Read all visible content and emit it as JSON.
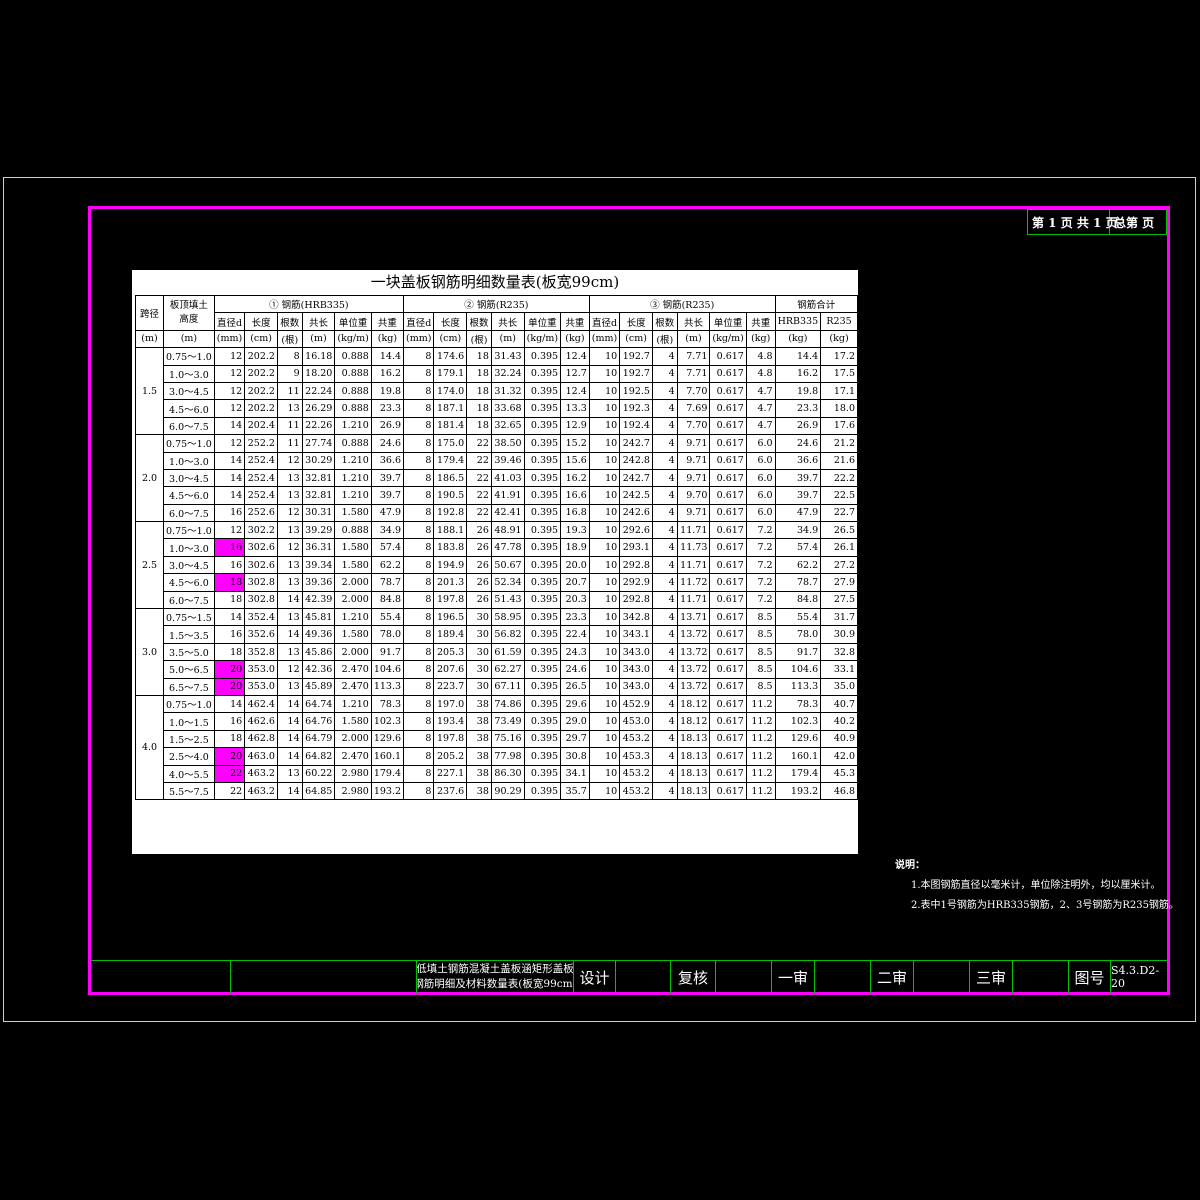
{
  "page_box": {
    "page_info": "第 1 页 共 1 页",
    "total_page": "总第   页"
  },
  "table_title": "一块盖板钢筋明细数量表(板宽99cm)",
  "headers": {
    "span": "跨径",
    "span_unit": "(m)",
    "fill": "板顶填土高度",
    "fill_unit": "(m)",
    "g1": "① 钢筋(HRB335)",
    "g2": "② 钢筋(R235)",
    "g3": "③ 钢筋(R235)",
    "g4": "钢筋合计",
    "dia": "直径d",
    "len": "长度",
    "cnt": "根数",
    "tot": "共长",
    "uw": "单位重",
    "wt": "共重",
    "hrb": "HRB335",
    "r235": "R235",
    "u_dia": "(mm)",
    "u_len": "(cm)",
    "u_cnt": "(根)",
    "u_tot": "(m)",
    "u_uw": "(kg/m)",
    "u_wt": "(kg)"
  },
  "groups": [
    {
      "span": "1.5",
      "rows": [
        {
          "h": "0.75～1.0",
          "d1": "12",
          "l1": "202.2",
          "n1": "8",
          "t1": "16.18",
          "u1": "0.888",
          "w1": "14.4",
          "d2": "8",
          "l2": "174.6",
          "n2": "18",
          "t2": "31.43",
          "u2": "0.395",
          "w2": "12.4",
          "d3": "10",
          "l3": "192.7",
          "n3": "4",
          "t3": "7.71",
          "u3": "0.617",
          "w3": "4.8",
          "s1": "14.4",
          "s2": "17.2"
        },
        {
          "h": "1.0～3.0",
          "d1": "12",
          "l1": "202.2",
          "n1": "9",
          "t1": "18.20",
          "u1": "0.888",
          "w1": "16.2",
          "d2": "8",
          "l2": "179.1",
          "n2": "18",
          "t2": "32.24",
          "u2": "0.395",
          "w2": "12.7",
          "d3": "10",
          "l3": "192.7",
          "n3": "4",
          "t3": "7.71",
          "u3": "0.617",
          "w3": "4.8",
          "s1": "16.2",
          "s2": "17.5"
        },
        {
          "h": "3.0～4.5",
          "d1": "12",
          "l1": "202.2",
          "n1": "11",
          "t1": "22.24",
          "u1": "0.888",
          "w1": "19.8",
          "d2": "8",
          "l2": "174.0",
          "n2": "18",
          "t2": "31.32",
          "u2": "0.395",
          "w2": "12.4",
          "d3": "10",
          "l3": "192.5",
          "n3": "4",
          "t3": "7.70",
          "u3": "0.617",
          "w3": "4.7",
          "s1": "19.8",
          "s2": "17.1"
        },
        {
          "h": "4.5～6.0",
          "d1": "12",
          "l1": "202.2",
          "n1": "13",
          "t1": "26.29",
          "u1": "0.888",
          "w1": "23.3",
          "d2": "8",
          "l2": "187.1",
          "n2": "18",
          "t2": "33.68",
          "u2": "0.395",
          "w2": "13.3",
          "d3": "10",
          "l3": "192.3",
          "n3": "4",
          "t3": "7.69",
          "u3": "0.617",
          "w3": "4.7",
          "s1": "23.3",
          "s2": "18.0"
        },
        {
          "h": "6.0～7.5",
          "d1": "14",
          "l1": "202.4",
          "n1": "11",
          "t1": "22.26",
          "u1": "1.210",
          "w1": "26.9",
          "d2": "8",
          "l2": "181.4",
          "n2": "18",
          "t2": "32.65",
          "u2": "0.395",
          "w2": "12.9",
          "d3": "10",
          "l3": "192.4",
          "n3": "4",
          "t3": "7.70",
          "u3": "0.617",
          "w3": "4.7",
          "s1": "26.9",
          "s2": "17.6"
        }
      ]
    },
    {
      "span": "2.0",
      "rows": [
        {
          "h": "0.75～1.0",
          "d1": "12",
          "l1": "252.2",
          "n1": "11",
          "t1": "27.74",
          "u1": "0.888",
          "w1": "24.6",
          "d2": "8",
          "l2": "175.0",
          "n2": "22",
          "t2": "38.50",
          "u2": "0.395",
          "w2": "15.2",
          "d3": "10",
          "l3": "242.7",
          "n3": "4",
          "t3": "9.71",
          "u3": "0.617",
          "w3": "6.0",
          "s1": "24.6",
          "s2": "21.2"
        },
        {
          "h": "1.0～3.0",
          "d1": "14",
          "l1": "252.4",
          "n1": "12",
          "t1": "30.29",
          "u1": "1.210",
          "w1": "36.6",
          "d2": "8",
          "l2": "179.4",
          "n2": "22",
          "t2": "39.46",
          "u2": "0.395",
          "w2": "15.6",
          "d3": "10",
          "l3": "242.8",
          "n3": "4",
          "t3": "9.71",
          "u3": "0.617",
          "w3": "6.0",
          "s1": "36.6",
          "s2": "21.6"
        },
        {
          "h": "3.0～4.5",
          "d1": "14",
          "l1": "252.4",
          "n1": "13",
          "t1": "32.81",
          "u1": "1.210",
          "w1": "39.7",
          "d2": "8",
          "l2": "186.5",
          "n2": "22",
          "t2": "41.03",
          "u2": "0.395",
          "w2": "16.2",
          "d3": "10",
          "l3": "242.7",
          "n3": "4",
          "t3": "9.71",
          "u3": "0.617",
          "w3": "6.0",
          "s1": "39.7",
          "s2": "22.2"
        },
        {
          "h": "4.5～6.0",
          "d1": "14",
          "l1": "252.4",
          "n1": "13",
          "t1": "32.81",
          "u1": "1.210",
          "w1": "39.7",
          "d2": "8",
          "l2": "190.5",
          "n2": "22",
          "t2": "41.91",
          "u2": "0.395",
          "w2": "16.6",
          "d3": "10",
          "l3": "242.5",
          "n3": "4",
          "t3": "9.70",
          "u3": "0.617",
          "w3": "6.0",
          "s1": "39.7",
          "s2": "22.5"
        },
        {
          "h": "6.0～7.5",
          "d1": "16",
          "l1": "252.6",
          "n1": "12",
          "t1": "30.31",
          "u1": "1.580",
          "w1": "47.9",
          "d2": "8",
          "l2": "192.8",
          "n2": "22",
          "t2": "42.41",
          "u2": "0.395",
          "w2": "16.8",
          "d3": "10",
          "l3": "242.6",
          "n3": "4",
          "t3": "9.71",
          "u3": "0.617",
          "w3": "6.0",
          "s1": "47.9",
          "s2": "22.7"
        }
      ]
    },
    {
      "span": "2.5",
      "rows": [
        {
          "h": "0.75～1.0",
          "d1": "12",
          "l1": "302.2",
          "n1": "13",
          "t1": "39.29",
          "u1": "0.888",
          "w1": "34.9",
          "d2": "8",
          "l2": "188.1",
          "n2": "26",
          "t2": "48.91",
          "u2": "0.395",
          "w2": "19.3",
          "d3": "10",
          "l3": "292.6",
          "n3": "4",
          "t3": "11.71",
          "u3": "0.617",
          "w3": "7.2",
          "s1": "34.9",
          "s2": "26.5"
        },
        {
          "h": "1.0～3.0",
          "d1": "16",
          "l1": "302.6",
          "n1": "12",
          "t1": "36.31",
          "u1": "1.580",
          "w1": "57.4",
          "d2": "8",
          "l2": "183.8",
          "n2": "26",
          "t2": "47.78",
          "u2": "0.395",
          "w2": "18.9",
          "d3": "10",
          "l3": "293.1",
          "n3": "4",
          "t3": "11.73",
          "u3": "0.617",
          "w3": "7.2",
          "s1": "57.4",
          "s2": "26.1",
          "hl": true
        },
        {
          "h": "3.0～4.5",
          "d1": "16",
          "l1": "302.6",
          "n1": "13",
          "t1": "39.34",
          "u1": "1.580",
          "w1": "62.2",
          "d2": "8",
          "l2": "194.9",
          "n2": "26",
          "t2": "50.67",
          "u2": "0.395",
          "w2": "20.0",
          "d3": "10",
          "l3": "292.8",
          "n3": "4",
          "t3": "11.71",
          "u3": "0.617",
          "w3": "7.2",
          "s1": "62.2",
          "s2": "27.2"
        },
        {
          "h": "4.5～6.0",
          "d1": "18",
          "l1": "302.8",
          "n1": "13",
          "t1": "39.36",
          "u1": "2.000",
          "w1": "78.7",
          "d2": "8",
          "l2": "201.3",
          "n2": "26",
          "t2": "52.34",
          "u2": "0.395",
          "w2": "20.7",
          "d3": "10",
          "l3": "292.9",
          "n3": "4",
          "t3": "11.72",
          "u3": "0.617",
          "w3": "7.2",
          "s1": "78.7",
          "s2": "27.9",
          "hl": true
        },
        {
          "h": "6.0～7.5",
          "d1": "18",
          "l1": "302.8",
          "n1": "14",
          "t1": "42.39",
          "u1": "2.000",
          "w1": "84.8",
          "d2": "8",
          "l2": "197.8",
          "n2": "26",
          "t2": "51.43",
          "u2": "0.395",
          "w2": "20.3",
          "d3": "10",
          "l3": "292.8",
          "n3": "4",
          "t3": "11.71",
          "u3": "0.617",
          "w3": "7.2",
          "s1": "84.8",
          "s2": "27.5"
        }
      ]
    },
    {
      "span": "3.0",
      "rows": [
        {
          "h": "0.75～1.5",
          "d1": "14",
          "l1": "352.4",
          "n1": "13",
          "t1": "45.81",
          "u1": "1.210",
          "w1": "55.4",
          "d2": "8",
          "l2": "196.5",
          "n2": "30",
          "t2": "58.95",
          "u2": "0.395",
          "w2": "23.3",
          "d3": "10",
          "l3": "342.8",
          "n3": "4",
          "t3": "13.71",
          "u3": "0.617",
          "w3": "8.5",
          "s1": "55.4",
          "s2": "31.7"
        },
        {
          "h": "1.5～3.5",
          "d1": "16",
          "l1": "352.6",
          "n1": "14",
          "t1": "49.36",
          "u1": "1.580",
          "w1": "78.0",
          "d2": "8",
          "l2": "189.4",
          "n2": "30",
          "t2": "56.82",
          "u2": "0.395",
          "w2": "22.4",
          "d3": "10",
          "l3": "343.1",
          "n3": "4",
          "t3": "13.72",
          "u3": "0.617",
          "w3": "8.5",
          "s1": "78.0",
          "s2": "30.9"
        },
        {
          "h": "3.5～5.0",
          "d1": "18",
          "l1": "352.8",
          "n1": "13",
          "t1": "45.86",
          "u1": "2.000",
          "w1": "91.7",
          "d2": "8",
          "l2": "205.3",
          "n2": "30",
          "t2": "61.59",
          "u2": "0.395",
          "w2": "24.3",
          "d3": "10",
          "l3": "343.0",
          "n3": "4",
          "t3": "13.72",
          "u3": "0.617",
          "w3": "8.5",
          "s1": "91.7",
          "s2": "32.8"
        },
        {
          "h": "5.0～6.5",
          "d1": "20",
          "l1": "353.0",
          "n1": "12",
          "t1": "42.36",
          "u1": "2.470",
          "w1": "104.6",
          "d2": "8",
          "l2": "207.6",
          "n2": "30",
          "t2": "62.27",
          "u2": "0.395",
          "w2": "24.6",
          "d3": "10",
          "l3": "343.0",
          "n3": "4",
          "t3": "13.72",
          "u3": "0.617",
          "w3": "8.5",
          "s1": "104.6",
          "s2": "33.1",
          "hl": true
        },
        {
          "h": "6.5～7.5",
          "d1": "20",
          "l1": "353.0",
          "n1": "13",
          "t1": "45.89",
          "u1": "2.470",
          "w1": "113.3",
          "d2": "8",
          "l2": "223.7",
          "n2": "30",
          "t2": "67.11",
          "u2": "0.395",
          "w2": "26.5",
          "d3": "10",
          "l3": "343.0",
          "n3": "4",
          "t3": "13.72",
          "u3": "0.617",
          "w3": "8.5",
          "s1": "113.3",
          "s2": "35.0",
          "hl": true
        }
      ]
    },
    {
      "span": "4.0",
      "rows": [
        {
          "h": "0.75～1.0",
          "d1": "14",
          "l1": "462.4",
          "n1": "14",
          "t1": "64.74",
          "u1": "1.210",
          "w1": "78.3",
          "d2": "8",
          "l2": "197.0",
          "n2": "38",
          "t2": "74.86",
          "u2": "0.395",
          "w2": "29.6",
          "d3": "10",
          "l3": "452.9",
          "n3": "4",
          "t3": "18.12",
          "u3": "0.617",
          "w3": "11.2",
          "s1": "78.3",
          "s2": "40.7"
        },
        {
          "h": "1.0～1.5",
          "d1": "16",
          "l1": "462.6",
          "n1": "14",
          "t1": "64.76",
          "u1": "1.580",
          "w1": "102.3",
          "d2": "8",
          "l2": "193.4",
          "n2": "38",
          "t2": "73.49",
          "u2": "0.395",
          "w2": "29.0",
          "d3": "10",
          "l3": "453.0",
          "n3": "4",
          "t3": "18.12",
          "u3": "0.617",
          "w3": "11.2",
          "s1": "102.3",
          "s2": "40.2"
        },
        {
          "h": "1.5～2.5",
          "d1": "18",
          "l1": "462.8",
          "n1": "14",
          "t1": "64.79",
          "u1": "2.000",
          "w1": "129.6",
          "d2": "8",
          "l2": "197.8",
          "n2": "38",
          "t2": "75.16",
          "u2": "0.395",
          "w2": "29.7",
          "d3": "10",
          "l3": "453.2",
          "n3": "4",
          "t3": "18.13",
          "u3": "0.617",
          "w3": "11.2",
          "s1": "129.6",
          "s2": "40.9"
        },
        {
          "h": "2.5～4.0",
          "d1": "20",
          "l1": "463.0",
          "n1": "14",
          "t1": "64.82",
          "u1": "2.470",
          "w1": "160.1",
          "d2": "8",
          "l2": "205.2",
          "n2": "38",
          "t2": "77.98",
          "u2": "0.395",
          "w2": "30.8",
          "d3": "10",
          "l3": "453.3",
          "n3": "4",
          "t3": "18.13",
          "u3": "0.617",
          "w3": "11.2",
          "s1": "160.1",
          "s2": "42.0",
          "hl": true
        },
        {
          "h": "4.0～5.5",
          "d1": "22",
          "l1": "463.2",
          "n1": "13",
          "t1": "60.22",
          "u1": "2.980",
          "w1": "179.4",
          "d2": "8",
          "l2": "227.1",
          "n2": "38",
          "t2": "86.30",
          "u2": "0.395",
          "w2": "34.1",
          "d3": "10",
          "l3": "453.2",
          "n3": "4",
          "t3": "18.13",
          "u3": "0.617",
          "w3": "11.2",
          "s1": "179.4",
          "s2": "45.3",
          "hl": true
        },
        {
          "h": "5.5～7.5",
          "d1": "22",
          "l1": "463.2",
          "n1": "14",
          "t1": "64.85",
          "u1": "2.980",
          "w1": "193.2",
          "d2": "8",
          "l2": "237.6",
          "n2": "38",
          "t2": "90.29",
          "u2": "0.395",
          "w2": "35.7",
          "d3": "10",
          "l3": "453.2",
          "n3": "4",
          "t3": "18.13",
          "u3": "0.617",
          "w3": "11.2",
          "s1": "193.2",
          "s2": "46.8"
        }
      ]
    }
  ],
  "notes": {
    "title": "说明：",
    "items": [
      "1.本图钢筋直径以毫米计，单位除注明外，均以厘米计。",
      "2.表中1号钢筋为HRB335钢筋，2、3号钢筋为R235钢筋。"
    ]
  },
  "title_block": {
    "drawing_title_line1": "低填土钢筋混凝土盖板涵矩形盖板",
    "drawing_title_line2": "钢筋明细及材料数量表(板宽99cm)",
    "design": "设计",
    "check": "复核",
    "review1": "一审",
    "review2": "二审",
    "review3": "三审",
    "drawing_no_label": "图号",
    "drawing_no": "S4.3.D2-20"
  },
  "colors": {
    "frame": "#ff00ff",
    "title_block_lines": "#00c000",
    "highlight": "#ff00ff",
    "background": "#000000"
  }
}
